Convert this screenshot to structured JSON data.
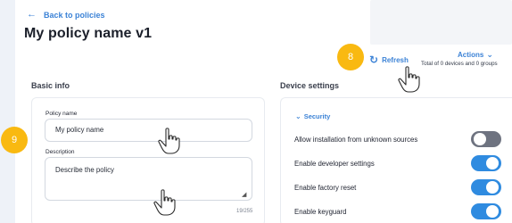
{
  "header": {
    "back_label": "Back to policies",
    "title": "My policy name v1"
  },
  "toolbar": {
    "refresh_label": "Refresh",
    "actions_label": "Actions",
    "totals_text": "Total of 0 devices and 0 groups"
  },
  "badges": [
    "8",
    "9"
  ],
  "basic_info": {
    "title": "Basic info",
    "policy_name_label": "Policy name",
    "policy_name_value": "My policy name",
    "description_label": "Description",
    "description_value": "Describe the policy",
    "description_counter": "19/255"
  },
  "device_settings": {
    "title": "Device settings",
    "group_label": "Security",
    "settings": [
      {
        "label": "Allow installation from unknown sources",
        "enabled": false
      },
      {
        "label": "Enable developer settings",
        "enabled": true
      },
      {
        "label": "Enable factory reset",
        "enabled": true
      },
      {
        "label": "Enable keyguard",
        "enabled": true
      }
    ]
  },
  "colors": {
    "accent": "#3b82d6",
    "badge": "#f9b911",
    "toggle_on": "#2f8be0",
    "toggle_off": "#6e7380"
  },
  "icons": {
    "back": "arrow-left-icon",
    "refresh": "refresh-icon",
    "actions": "chevron-down-icon",
    "security": "chevron-down-icon",
    "pointer": "hand-pointer-icon"
  }
}
